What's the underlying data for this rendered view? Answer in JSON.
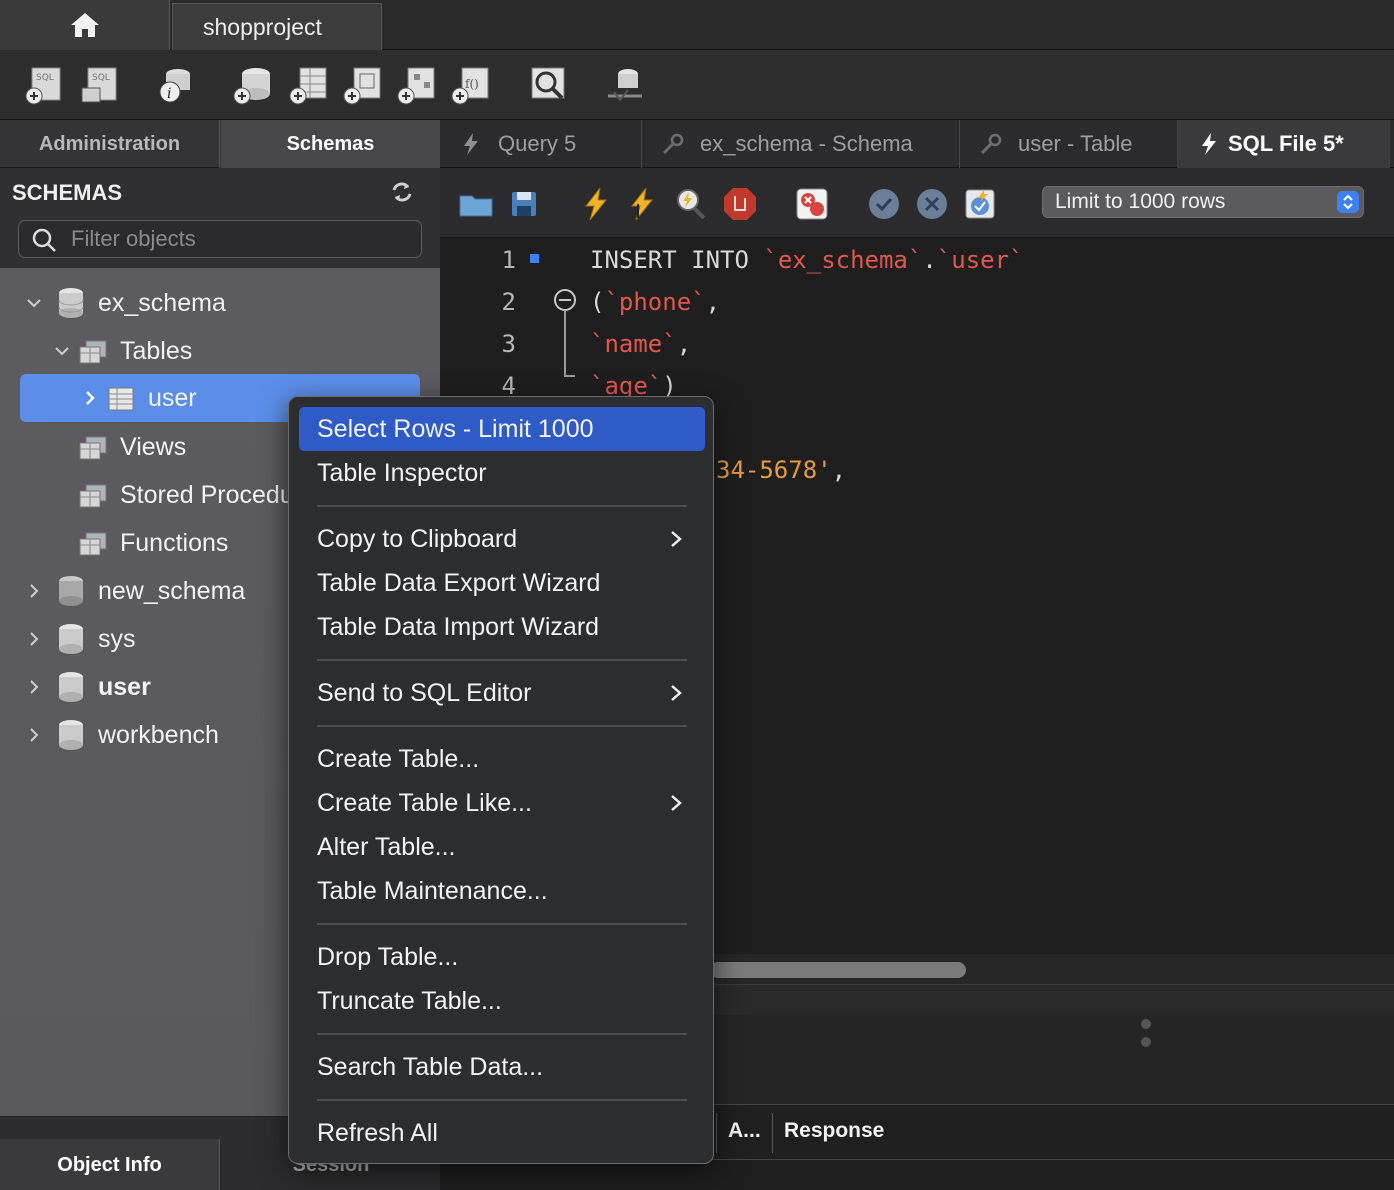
{
  "window": {
    "connection_tab": "shopproject"
  },
  "sidebar": {
    "tabs": {
      "administration": "Administration",
      "schemas": "Schemas"
    },
    "schemas_title": "SCHEMAS",
    "filter_placeholder": "Filter objects",
    "tree": {
      "ex_schema": "ex_schema",
      "tables": "Tables",
      "user_table": "user",
      "views": "Views",
      "stored_procedures": "Stored Procedures",
      "functions": "Functions",
      "new_schema": "new_schema",
      "sys": "sys",
      "user_schema": "user",
      "workbench": "workbench"
    },
    "bottom_tabs": {
      "object_info": "Object Info",
      "session": "Session"
    }
  },
  "editor": {
    "tabs": [
      {
        "label": "Query 5"
      },
      {
        "label": "ex_schema - Schema"
      },
      {
        "label": "user - Table"
      },
      {
        "label": "SQL File 5*"
      }
    ],
    "limit_select": "Limit to 1000 rows",
    "line_numbers": [
      "1",
      "2",
      "3",
      "4"
    ],
    "code": {
      "l1_kw": "INSERT INTO ",
      "l1_schema": "`ex_schema`",
      "l1_dot": ".",
      "l1_table": "`user`",
      "l2_paren": "(",
      "l2_col": "`phone`",
      "l2_comma": ",",
      "l3_col": "`name`",
      "l3_comma": ",",
      "l4_col": "`age`",
      "l4_paren": ")",
      "l6_str": "34-5678'",
      "l6_comma": ","
    },
    "output_headers": {
      "action": "A...",
      "response": "Response"
    }
  },
  "context_menu": {
    "items": [
      {
        "label": "Select Rows - Limit 1000"
      },
      {
        "label": "Table Inspector"
      },
      {
        "label": "Copy to Clipboard"
      },
      {
        "label": "Table Data Export Wizard"
      },
      {
        "label": "Table Data Import Wizard"
      },
      {
        "label": "Send to SQL Editor"
      },
      {
        "label": "Create Table..."
      },
      {
        "label": "Create Table Like..."
      },
      {
        "label": "Alter Table..."
      },
      {
        "label": "Table Maintenance..."
      },
      {
        "label": "Drop Table..."
      },
      {
        "label": "Truncate Table..."
      },
      {
        "label": "Search Table Data..."
      },
      {
        "label": "Refresh All"
      }
    ]
  },
  "colors": {
    "selection": "#5b8ee8",
    "menu_highlight": "#2f5bc7",
    "identifier": "#e2574c",
    "string": "#e89a3c"
  }
}
